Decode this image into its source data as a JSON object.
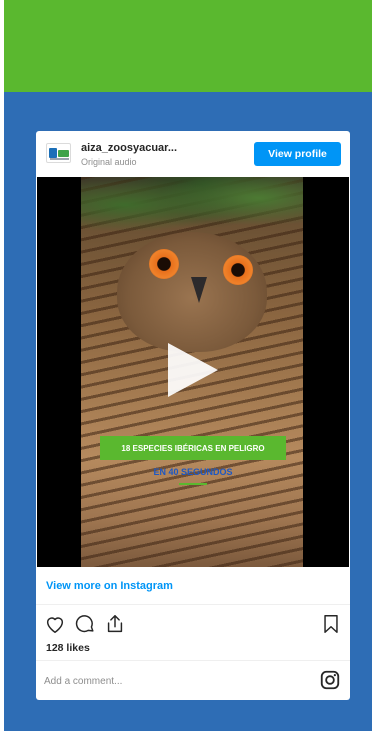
{
  "embed": {
    "username": "aiza_zoosyacuar...",
    "audio": "Original audio",
    "view_profile": "View profile"
  },
  "video": {
    "banner_text": "18 ESPECIES IBÉRICAS EN PELIGRO",
    "banner_subtext": "EN 40 SEGUNDOS"
  },
  "links": {
    "view_more": "View more on Instagram"
  },
  "actions": {
    "likes": "128 likes"
  },
  "comment": {
    "placeholder": "Add a comment..."
  },
  "icons": {
    "heart": "heart-icon",
    "comment": "comment-icon",
    "share": "share-icon",
    "bookmark": "bookmark-icon",
    "instagram": "instagram-icon",
    "play": "play-icon"
  },
  "colors": {
    "green_band": "#5ab82f",
    "blue_panel": "#2e6db5",
    "instagram_blue": "#0095f6",
    "banner_green": "#5ab82f",
    "banner_subtext": "#1e58c2"
  }
}
